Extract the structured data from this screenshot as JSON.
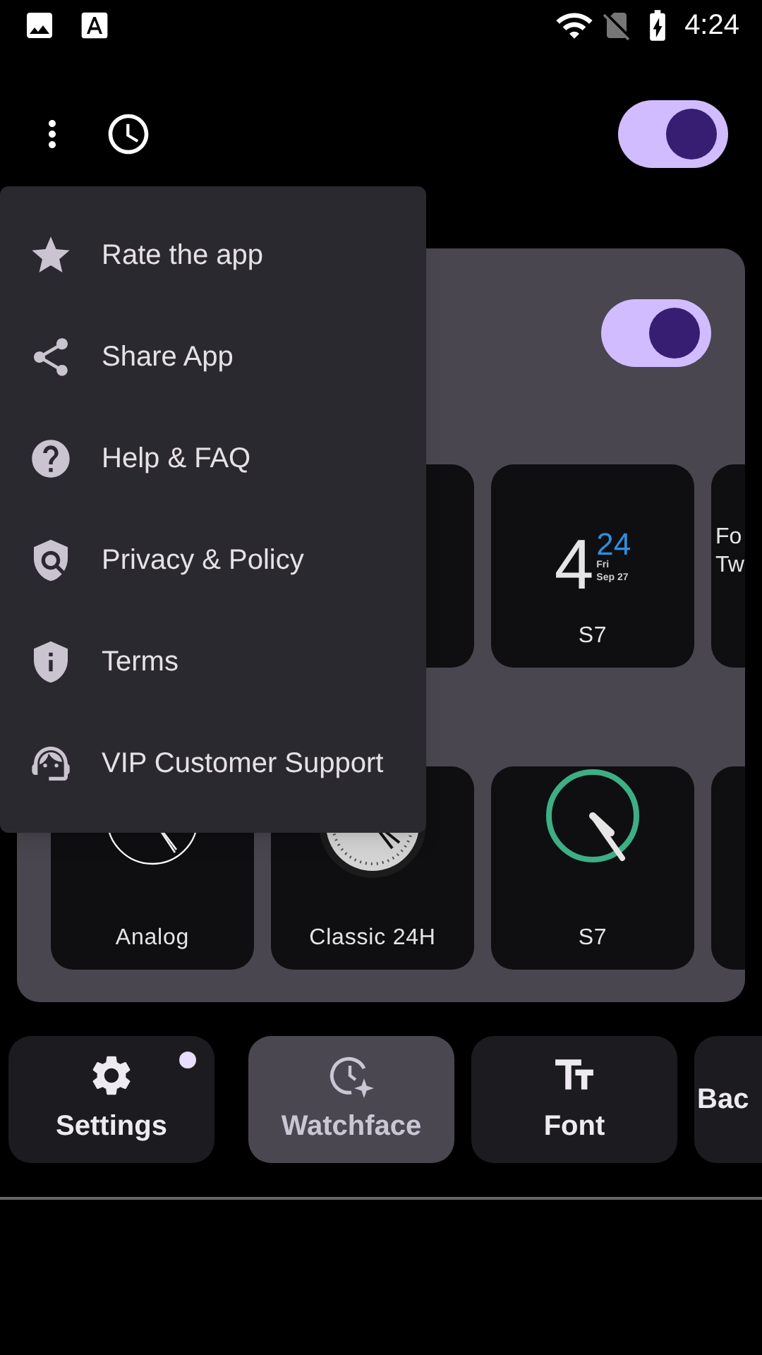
{
  "status_bar": {
    "time": "4:24"
  },
  "toolbar": {
    "toggle": {
      "on": true
    }
  },
  "card": {
    "toggle": {
      "on": true
    },
    "rows": [
      {
        "tiles": [
          {
            "kind": "blank"
          },
          {
            "kind": "digital",
            "hour": "4",
            "minute": "24",
            "day": "Fri",
            "date": "Sep 27",
            "label": "S7"
          },
          {
            "kind": "text",
            "lines": [
              "Fo",
              "Tw"
            ]
          }
        ]
      },
      {
        "tiles": [
          {
            "kind": "analog",
            "label": "Analog"
          },
          {
            "kind": "classic",
            "label": "Classic 24H"
          },
          {
            "kind": "ring",
            "label": "S7"
          },
          {
            "kind": "blank"
          }
        ]
      }
    ]
  },
  "menu": {
    "items": [
      {
        "kind": "star",
        "label": "Rate the app"
      },
      {
        "kind": "share",
        "label": "Share App"
      },
      {
        "kind": "help",
        "label": "Help & FAQ"
      },
      {
        "kind": "policy",
        "label": "Privacy & Policy"
      },
      {
        "kind": "terms",
        "label": "Terms"
      },
      {
        "kind": "support",
        "label": "VIP Customer Support"
      }
    ]
  },
  "bottom_nav": [
    {
      "kind": "settings",
      "label": "Settings",
      "selected": false,
      "badge": true
    },
    {
      "kind": "watchface",
      "label": "Watchface",
      "selected": true,
      "badge": false
    },
    {
      "kind": "font",
      "label": "Font",
      "selected": false,
      "badge": false
    },
    {
      "kind": "none",
      "label": "Bac",
      "selected": false,
      "badge": false
    }
  ]
}
